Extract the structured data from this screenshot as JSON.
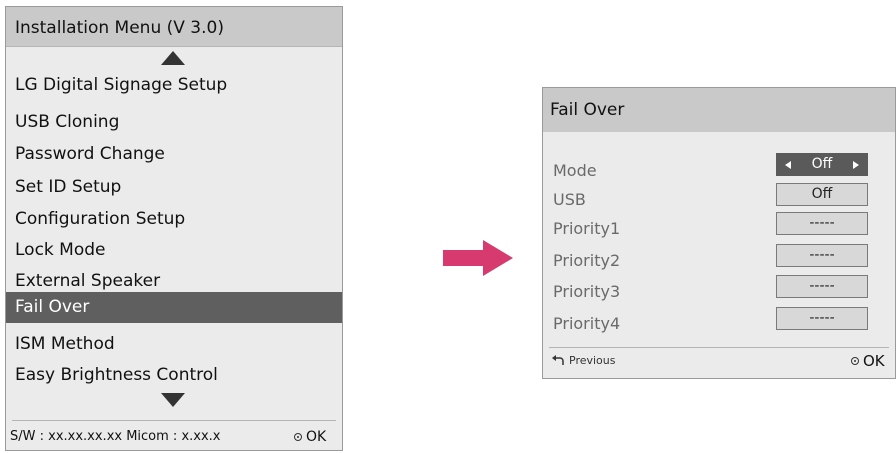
{
  "installation_menu": {
    "title": "Installation Menu (V 3.0)",
    "items": [
      {
        "label": "LG Digital Signage Setup"
      },
      {
        "label": "USB Cloning"
      },
      {
        "label": "Password Change"
      },
      {
        "label": "Set ID Setup"
      },
      {
        "label": "Configuration Setup"
      },
      {
        "label": "Lock Mode"
      },
      {
        "label": "External Speaker"
      },
      {
        "label": "Fail Over",
        "selected": true
      },
      {
        "label": "ISM Method"
      },
      {
        "label": "Easy Brightness Control"
      }
    ],
    "footer": {
      "sw_info": "S/W : xx.xx.xx.xx Micom : x.xx.x",
      "ok_label": "OK"
    }
  },
  "fail_over": {
    "title": "Fail Over",
    "rows": [
      {
        "label": "Mode",
        "value": "Off",
        "active": true
      },
      {
        "label": "USB",
        "value": "Off"
      },
      {
        "label": "Priority1",
        "value": "-----"
      },
      {
        "label": "Priority2",
        "value": "-----"
      },
      {
        "label": "Priority3",
        "value": "-----"
      },
      {
        "label": "Priority4",
        "value": "-----"
      }
    ],
    "footer": {
      "previous_label": "Previous",
      "ok_label": "OK"
    }
  },
  "colors": {
    "arrow": "#d63a6e",
    "selected_row": "#5f5f5f",
    "header": "#c9c9c9",
    "panel": "#ebebeb"
  },
  "icons": [
    "scroll-up-icon",
    "scroll-down-icon",
    "ok-button-icon",
    "previous-back-icon",
    "right-arrow-icon"
  ]
}
